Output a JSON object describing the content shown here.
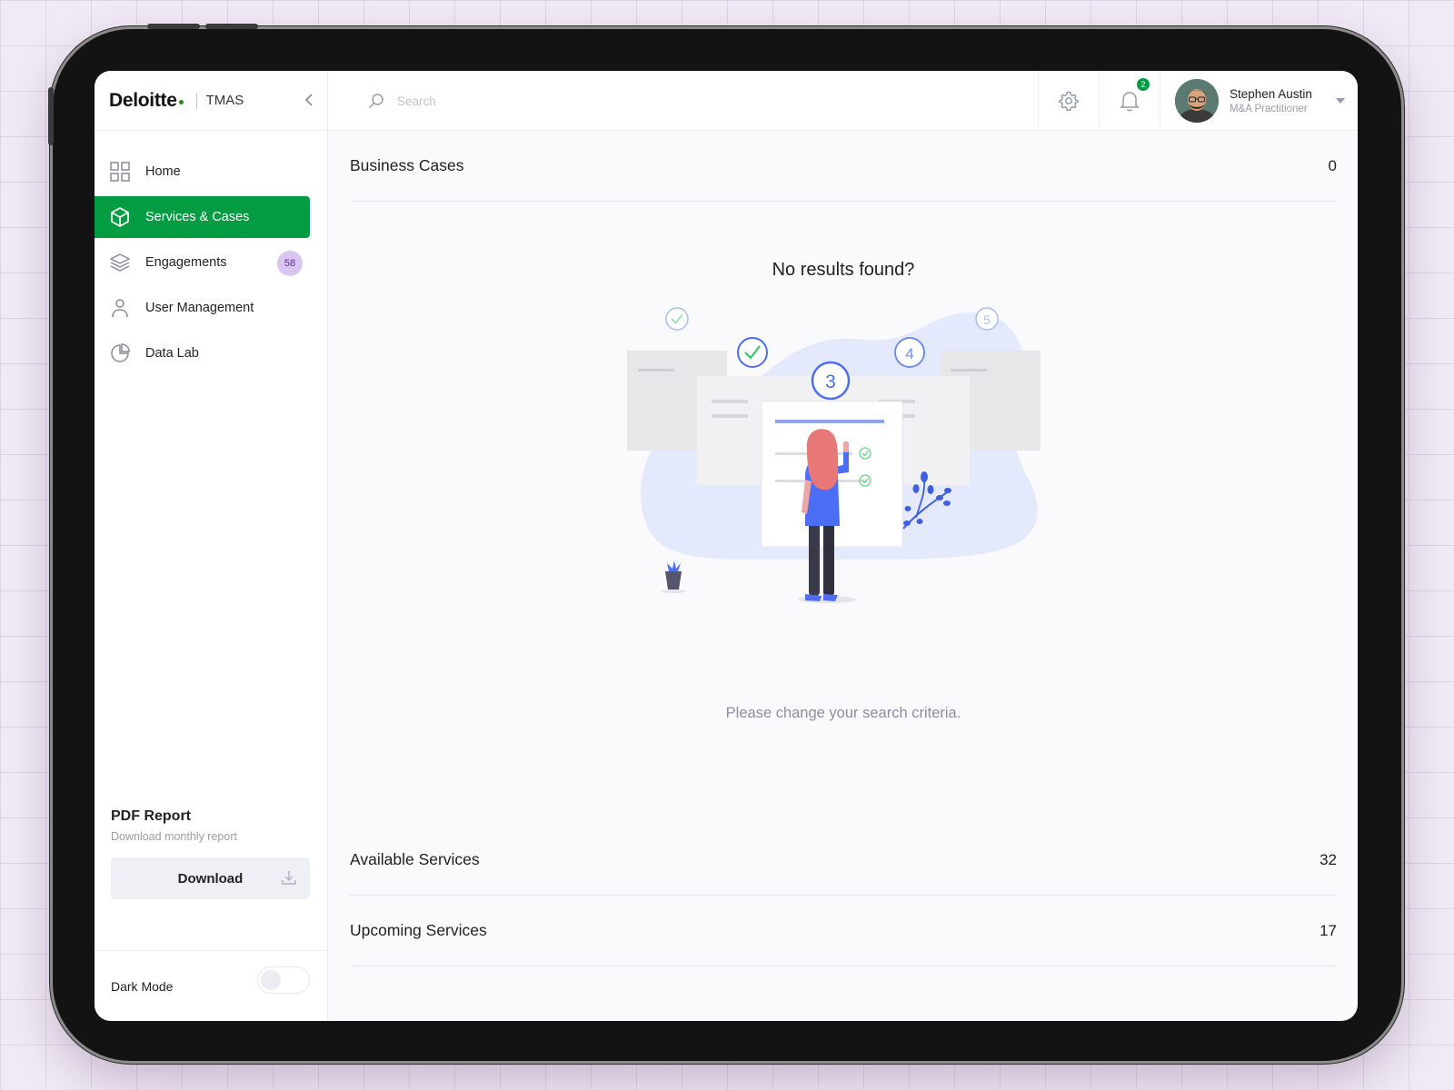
{
  "brand": {
    "logo": "Deloitte",
    "app": "TMAS"
  },
  "sidebar": {
    "items": [
      {
        "label": "Home",
        "icon": "grid-icon",
        "active": false
      },
      {
        "label": "Services & Cases",
        "icon": "cube-icon",
        "active": true
      },
      {
        "label": "Engagements",
        "icon": "layers-icon",
        "active": false,
        "badge": "58"
      },
      {
        "label": "User Management",
        "icon": "user-icon",
        "active": false
      },
      {
        "label": "Data Lab",
        "icon": "pie-chart-icon",
        "active": false
      }
    ],
    "pdf": {
      "title": "PDF Report",
      "subtitle": "Download monthly report",
      "button": "Download"
    },
    "dark_mode": {
      "label": "Dark Mode",
      "enabled": false
    }
  },
  "header": {
    "search_placeholder": "Search",
    "notifications": "2",
    "user": {
      "name": "Stephen Austin",
      "role": "M&A Practitioner"
    }
  },
  "main": {
    "sections": [
      {
        "label": "Business Cases",
        "count": "0"
      },
      {
        "label": "Available Services",
        "count": "32"
      },
      {
        "label": "Upcoming Services",
        "count": "17"
      }
    ],
    "empty": {
      "title": "No results found?",
      "subtitle": "Please change your search criteria.",
      "step_labels": [
        "3",
        "4",
        "5"
      ]
    }
  },
  "colors": {
    "accent": "#049c43",
    "badge_bg": "#d9c6f0",
    "badge_text": "#5d2c91",
    "illustration_blue": "#4c6ef5"
  }
}
